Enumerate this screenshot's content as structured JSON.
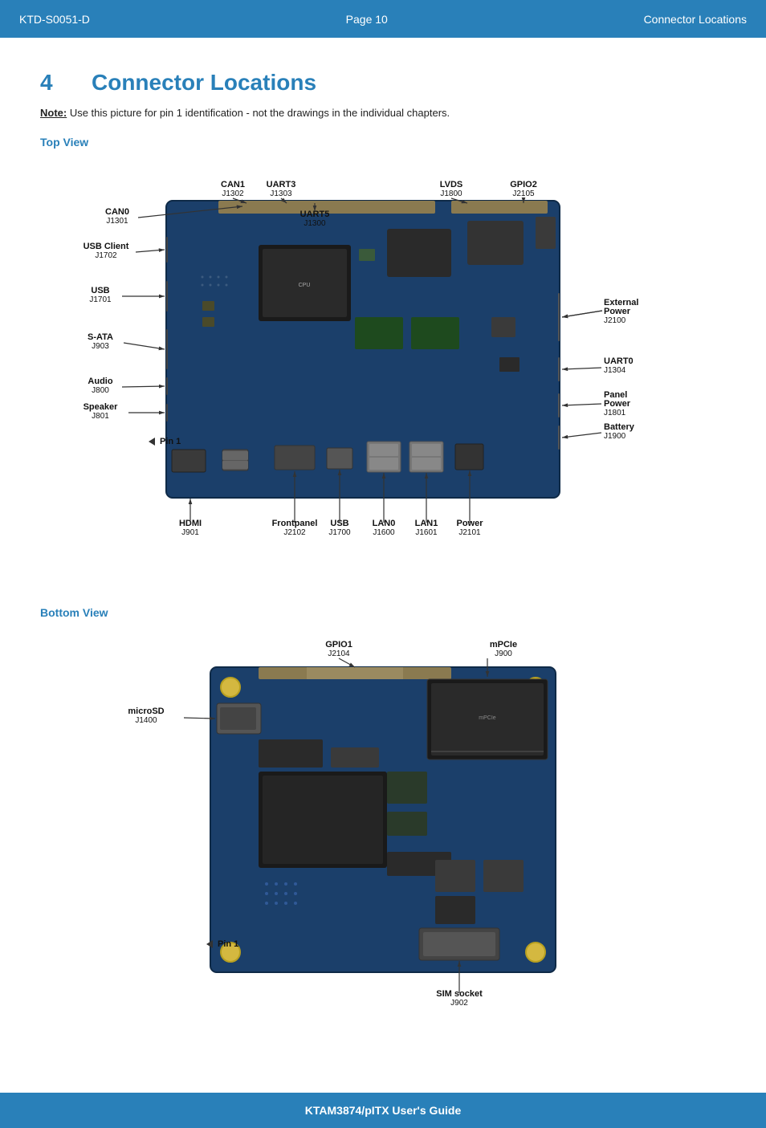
{
  "header": {
    "left": "KTD-S0051-D",
    "center": "Page 10",
    "right": "Connector Locations"
  },
  "section": {
    "number": "4",
    "title": "Connector Locations"
  },
  "note": {
    "label": "Note:",
    "text": " Use this picture for pin 1 identification - not the drawings in the individual chapters."
  },
  "top_view": {
    "label": "Top View",
    "connectors": [
      {
        "name": "CAN0",
        "id": "J1301"
      },
      {
        "name": "CAN1",
        "id": "J1302"
      },
      {
        "name": "UART3",
        "id": "J1303"
      },
      {
        "name": "LVDS",
        "id": "J1800"
      },
      {
        "name": "GPIO2",
        "id": "J2105"
      },
      {
        "name": "UART5",
        "id": "J1300"
      },
      {
        "name": "USB Client",
        "id": "J1702"
      },
      {
        "name": "USB",
        "id": "J1701"
      },
      {
        "name": "S-ATA",
        "id": "J903"
      },
      {
        "name": "Audio",
        "id": "J800"
      },
      {
        "name": "Speaker",
        "id": "J801"
      },
      {
        "name": "HDMI",
        "id": "J901"
      },
      {
        "name": "Frontpanel",
        "id": "J2102"
      },
      {
        "name": "USB",
        "id": "J1700"
      },
      {
        "name": "LAN0",
        "id": "J1600"
      },
      {
        "name": "LAN1",
        "id": "J1601"
      },
      {
        "name": "Power",
        "id": "J2101"
      },
      {
        "name": "External Power",
        "id": "J2100"
      },
      {
        "name": "UART0",
        "id": "J1304"
      },
      {
        "name": "Panel Power",
        "id": "J1801"
      },
      {
        "name": "Battery",
        "id": "J1900"
      }
    ],
    "pin1_label": "Pin 1"
  },
  "bottom_view": {
    "label": "Bottom View",
    "connectors": [
      {
        "name": "GPIO1",
        "id": "J2104"
      },
      {
        "name": "mPCIe",
        "id": "J900"
      },
      {
        "name": "microSD",
        "id": "J1400"
      },
      {
        "name": "SIM socket",
        "id": "J902"
      }
    ],
    "pin1_label": "Pin 1"
  },
  "footer": {
    "product": "KTAM3874/pITX",
    "text": " User's Guide"
  }
}
